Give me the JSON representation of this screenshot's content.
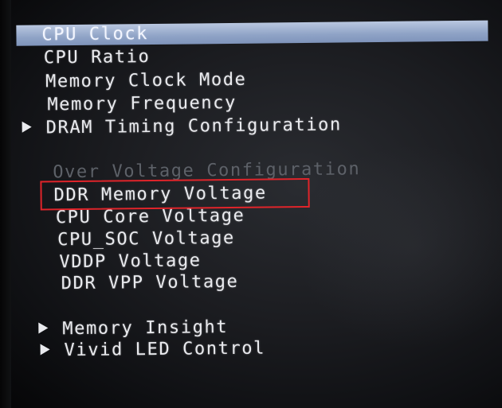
{
  "menu": {
    "items": [
      {
        "label": "CPU Clock"
      },
      {
        "label": "CPU Ratio"
      },
      {
        "label": "Memory Clock Mode"
      },
      {
        "label": "Memory Frequency"
      },
      {
        "label": "DRAM Timing Configuration"
      }
    ],
    "voltage_header": "Over Voltage Configuration",
    "voltage_items": [
      {
        "label": "DDR Memory Voltage"
      },
      {
        "label": "CPU Core Voltage"
      },
      {
        "label": "CPU_SOC Voltage"
      },
      {
        "label": "VDDP Voltage"
      },
      {
        "label": "DDR VPP Voltage"
      }
    ],
    "submenus": [
      {
        "label": "Memory Insight"
      },
      {
        "label": "Vivid LED Control"
      }
    ]
  },
  "colors": {
    "selection": "#9fb1d2",
    "annotation_box": "#e0242a",
    "text": "#e9eaee",
    "disabled_text": "#5d6168"
  }
}
